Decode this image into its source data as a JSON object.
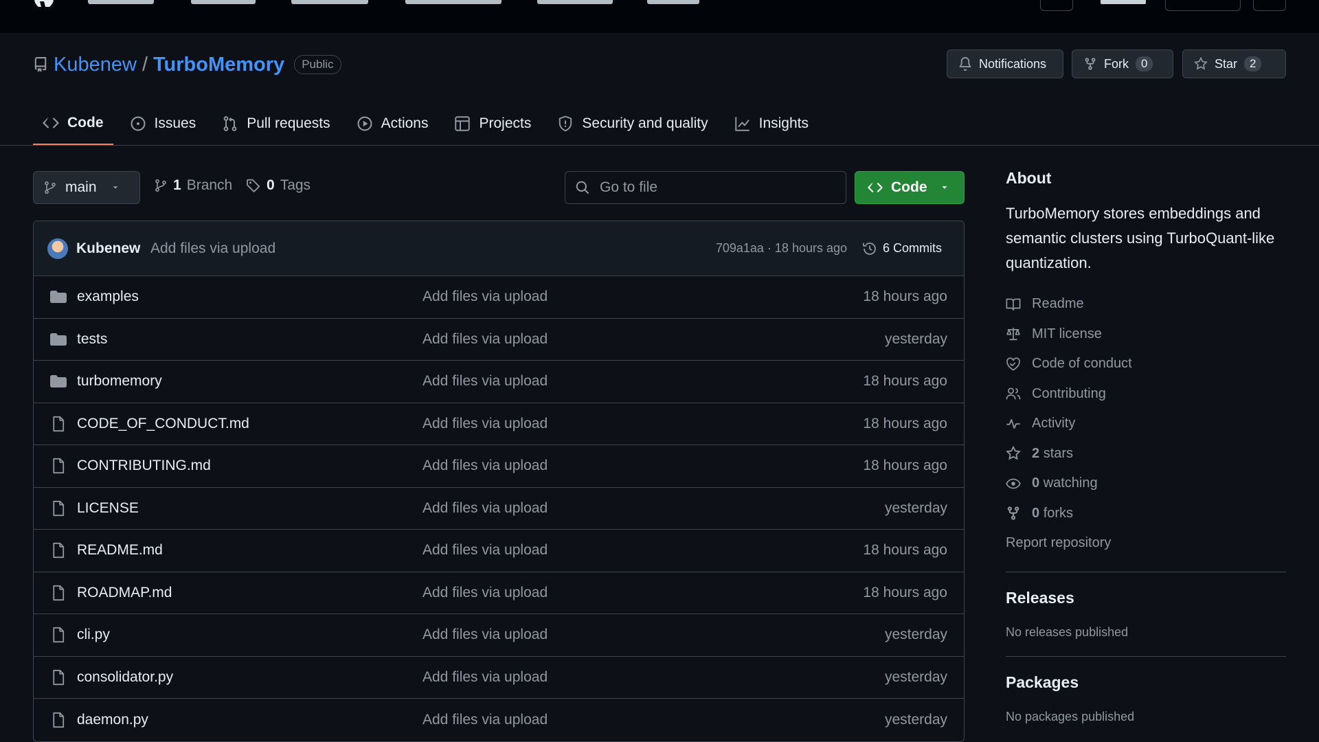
{
  "repo": {
    "owner": "Kubenew",
    "separator": "/",
    "name": "TurboMemory",
    "visibility": "Public"
  },
  "header_buttons": {
    "notifications": "Notifications",
    "fork_label": "Fork",
    "fork_count": "0",
    "star_label": "Star",
    "star_count": "2"
  },
  "tabs": [
    {
      "label": "Code",
      "icon": "code-icon",
      "active": true
    },
    {
      "label": "Issues",
      "icon": "issue-icon"
    },
    {
      "label": "Pull requests",
      "icon": "pull-request-icon"
    },
    {
      "label": "Actions",
      "icon": "play-icon"
    },
    {
      "label": "Projects",
      "icon": "table-icon"
    },
    {
      "label": "Security and quality",
      "icon": "shield-icon"
    },
    {
      "label": "Insights",
      "icon": "graph-icon"
    }
  ],
  "toolbar": {
    "branch": "main",
    "branch_count": "1",
    "branch_label": "Branch",
    "tag_count": "0",
    "tag_label": "Tags",
    "search_placeholder": "Go to file",
    "code_button": "Code"
  },
  "latest_commit": {
    "author": "Kubenew",
    "message": "Add files via upload",
    "hash_time": "709a1aa · 18 hours ago",
    "commits": "6 Commits"
  },
  "files": [
    {
      "type": "dir",
      "name": "examples",
      "message": "Add files via upload",
      "time": "18 hours ago"
    },
    {
      "type": "dir",
      "name": "tests",
      "message": "Add files via upload",
      "time": "yesterday"
    },
    {
      "type": "dir",
      "name": "turbomemory",
      "message": "Add files via upload",
      "time": "18 hours ago"
    },
    {
      "type": "file",
      "name": "CODE_OF_CONDUCT.md",
      "message": "Add files via upload",
      "time": "18 hours ago"
    },
    {
      "type": "file",
      "name": "CONTRIBUTING.md",
      "message": "Add files via upload",
      "time": "18 hours ago"
    },
    {
      "type": "file",
      "name": "LICENSE",
      "message": "Add files via upload",
      "time": "yesterday"
    },
    {
      "type": "file",
      "name": "README.md",
      "message": "Add files via upload",
      "time": "18 hours ago"
    },
    {
      "type": "file",
      "name": "ROADMAP.md",
      "message": "Add files via upload",
      "time": "18 hours ago"
    },
    {
      "type": "file",
      "name": "cli.py",
      "message": "Add files via upload",
      "time": "yesterday"
    },
    {
      "type": "file",
      "name": "consolidator.py",
      "message": "Add files via upload",
      "time": "yesterday"
    },
    {
      "type": "file",
      "name": "daemon.py",
      "message": "Add files via upload",
      "time": "yesterday"
    }
  ],
  "about": {
    "title": "About",
    "description": "TurboMemory stores embeddings and semantic clusters using TurboQuant-like quantization.",
    "items": [
      {
        "icon": "book-icon",
        "label": "Readme"
      },
      {
        "icon": "law-icon",
        "label": "MIT license"
      },
      {
        "icon": "code-of-conduct-icon",
        "label": "Code of conduct"
      },
      {
        "icon": "people-icon",
        "label": "Contributing"
      },
      {
        "icon": "pulse-icon",
        "label": "Activity"
      },
      {
        "icon": "star-icon",
        "count": "2",
        "label": "stars"
      },
      {
        "icon": "eye-icon",
        "count": "0",
        "label": "watching"
      },
      {
        "icon": "fork-icon",
        "count": "0",
        "label": "forks"
      }
    ],
    "report": "Report repository"
  },
  "releases": {
    "title": "Releases",
    "text": "No releases published"
  },
  "packages": {
    "title": "Packages",
    "text": "No packages published"
  },
  "colors": {
    "background": "#0d1117",
    "link": "#4493f8",
    "accent_green": "#238636",
    "tab_underline": "#f78166"
  }
}
